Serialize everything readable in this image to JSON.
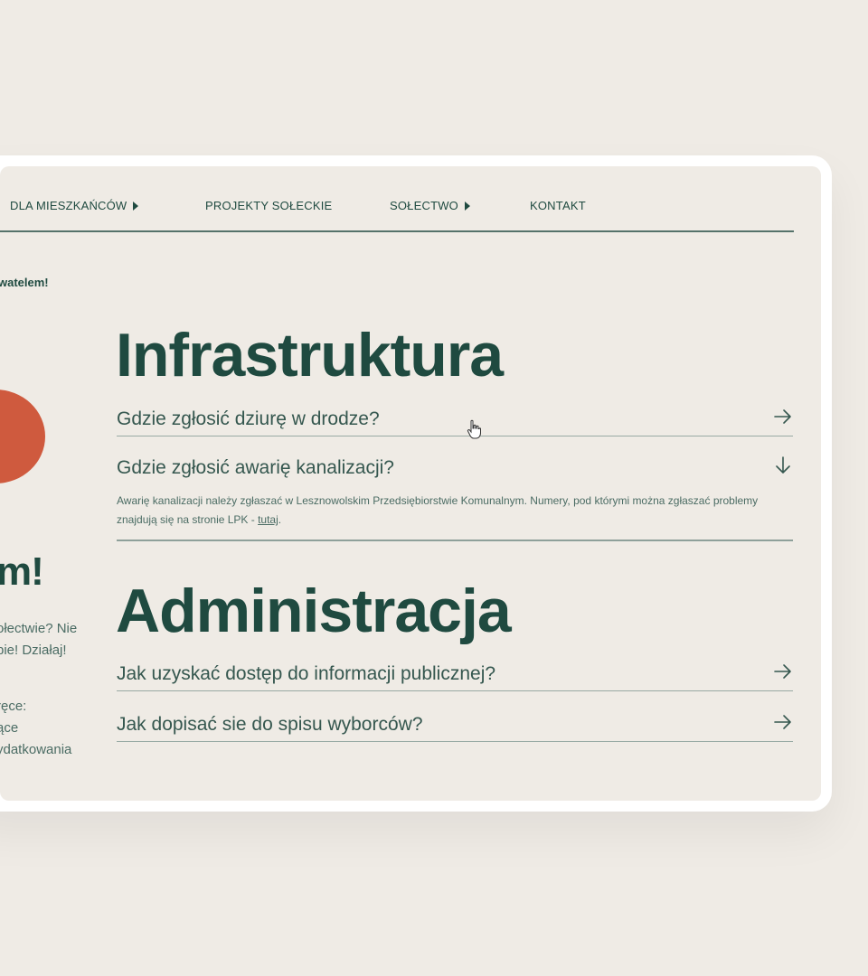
{
  "nav": {
    "items": [
      {
        "label": "DLA MIESZKAŃCÓW",
        "has_submenu": true
      },
      {
        "label": "PROJEKTY SOŁECKIE",
        "has_submenu": false
      },
      {
        "label": "SOŁECTWO",
        "has_submenu": true
      },
      {
        "label": "KONTAKT",
        "has_submenu": false
      }
    ]
  },
  "side": {
    "welcome_fragment": "watelem!",
    "heading_fragment": "m!",
    "text_lines": [
      "ołectwie? Nie",
      "bie! Działaj!",
      "ręce:",
      "ące",
      "ydatkowania"
    ]
  },
  "sections": [
    {
      "title": "Infrastruktura",
      "faqs": [
        {
          "question": "Gdzie zgłosić dziurę w drodze?",
          "state": "collapsed",
          "icon": "arrow-right-icon"
        },
        {
          "question": "Gdzie zgłosić awarię kanalizacji?",
          "state": "expanded",
          "icon": "arrow-down-icon",
          "answer_text": "Awarię kanalizacji należy zgłaszać w Lesznowolskim Przedsiębiorstwie Komunalnym. Numery, pod którymi można zgłaszać problemy znajdują się na stronie LPK - ",
          "answer_link": "tutaj",
          "answer_end": "."
        }
      ]
    },
    {
      "title": "Administracja",
      "faqs": [
        {
          "question": "Jak uzyskać dostęp do informacji publicznej?",
          "state": "collapsed",
          "icon": "arrow-right-icon"
        },
        {
          "question": "Jak dopisać sie do spisu wyborców?",
          "state": "collapsed",
          "icon": "arrow-right-icon"
        }
      ]
    }
  ],
  "colors": {
    "background": "#efebe5",
    "primary_green": "#1f4a40",
    "accent_orange": "#cf5a3e",
    "frame": "#ffffff"
  }
}
